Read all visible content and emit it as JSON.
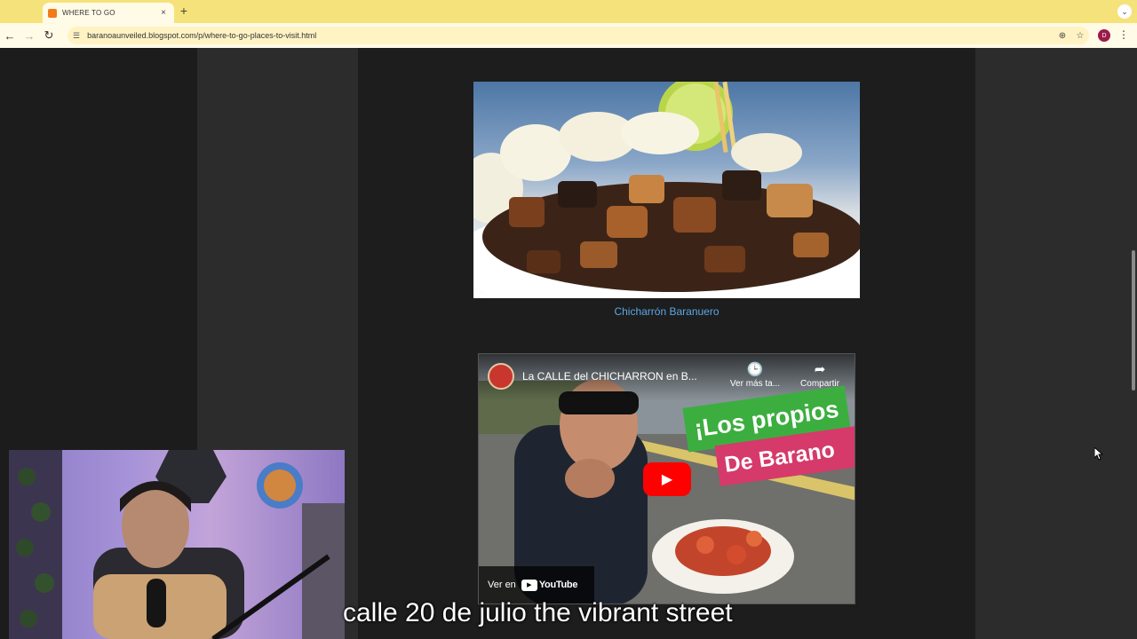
{
  "browser": {
    "tab_title": "WHERE TO GO",
    "tab_close": "×",
    "new_tab": "+",
    "tab_menu": "⌄",
    "url": "baranoaunveiled.blogspot.com/p/where-to-go-places-to-visit.html",
    "profile_initial": "D",
    "colors": {
      "tabbar": "#f6e27a",
      "toolbar": "#fffbe6",
      "profile": "#9b1b4a"
    }
  },
  "article": {
    "image_caption": "Chicharrón Baranuero"
  },
  "video": {
    "title": "La CALLE del CHICHARRON en B...",
    "watch_later_label": "Ver más ta...",
    "share_label": "Compartir",
    "watch_on_label": "Ver en",
    "youtube_label": "YouTube",
    "promo_line1": "¡Los propios",
    "promo_line2": "De Barano",
    "colors": {
      "play": "#ff0000",
      "promo_green": "#3cae3f",
      "promo_pink": "#d53a6a"
    }
  },
  "overlay": {
    "subtitle": "calle 20 de julio the vibrant street"
  }
}
